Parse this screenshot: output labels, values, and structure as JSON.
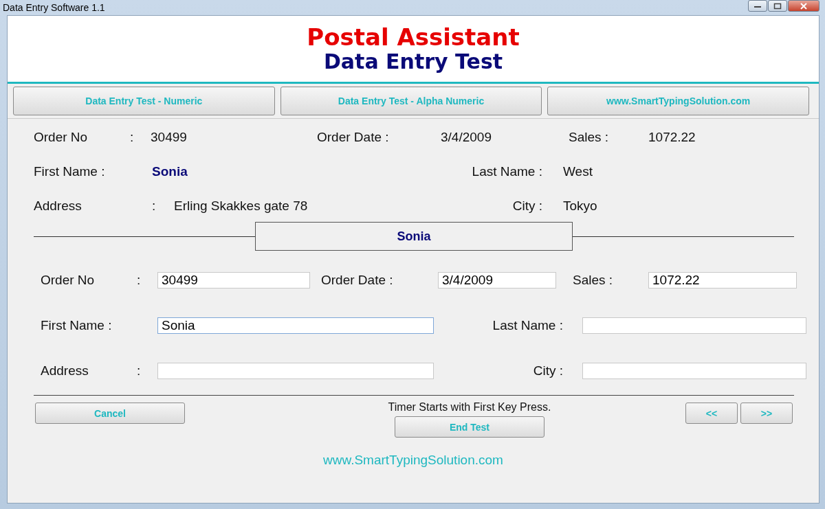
{
  "window": {
    "title": "Data Entry Software 1.1"
  },
  "header": {
    "title": "Postal Assistant",
    "subtitle": "Data Entry Test"
  },
  "nav_buttons": [
    "Data Entry Test - Numeric",
    "Data Entry Test - Alpha Numeric",
    "www.SmartTypingSolution.com"
  ],
  "record": [
    [
      {
        "label": "Order No",
        "colon": ":",
        "value": "30499",
        "highlight": false
      },
      {
        "label": "Order Date :",
        "value": "3/4/2009",
        "highlight": false
      },
      {
        "label": "Sales :",
        "value": "1072.22",
        "highlight": false
      }
    ],
    [
      {
        "label": "First Name :",
        "value": "Sonia",
        "highlight": true
      },
      {
        "label": "Last Name :",
        "value": "West",
        "highlight": false
      }
    ],
    [
      {
        "label": "Address",
        "colon": ":",
        "value": "Erling Skakkes gate 78",
        "highlight": false
      },
      {
        "label": "City :",
        "value": "Tokyo",
        "highlight": false
      }
    ]
  ],
  "current_word": "Sonia",
  "form": [
    [
      {
        "label": "Order No",
        "colon": ":",
        "value": "30499",
        "focused": false
      },
      {
        "label": "Order Date :",
        "value": "3/4/2009",
        "focused": false
      },
      {
        "label": "Sales :",
        "value": "1072.22",
        "focused": false
      }
    ],
    [
      {
        "label": "First Name :",
        "value": "Sonia",
        "focused": true
      },
      {
        "label": "Last Name :",
        "focused": false
      }
    ],
    [
      {
        "label": "Address",
        "colon": ":",
        "focused": false
      },
      {
        "label": "City :",
        "focused": false
      }
    ]
  ],
  "cancel_button": "Cancel",
  "timer_note": "Timer Starts with First Key Press.",
  "end_button": "End Test",
  "prev_button": "<<",
  "next_button": ">>",
  "footer_link": "www.SmartTypingSolution.com"
}
